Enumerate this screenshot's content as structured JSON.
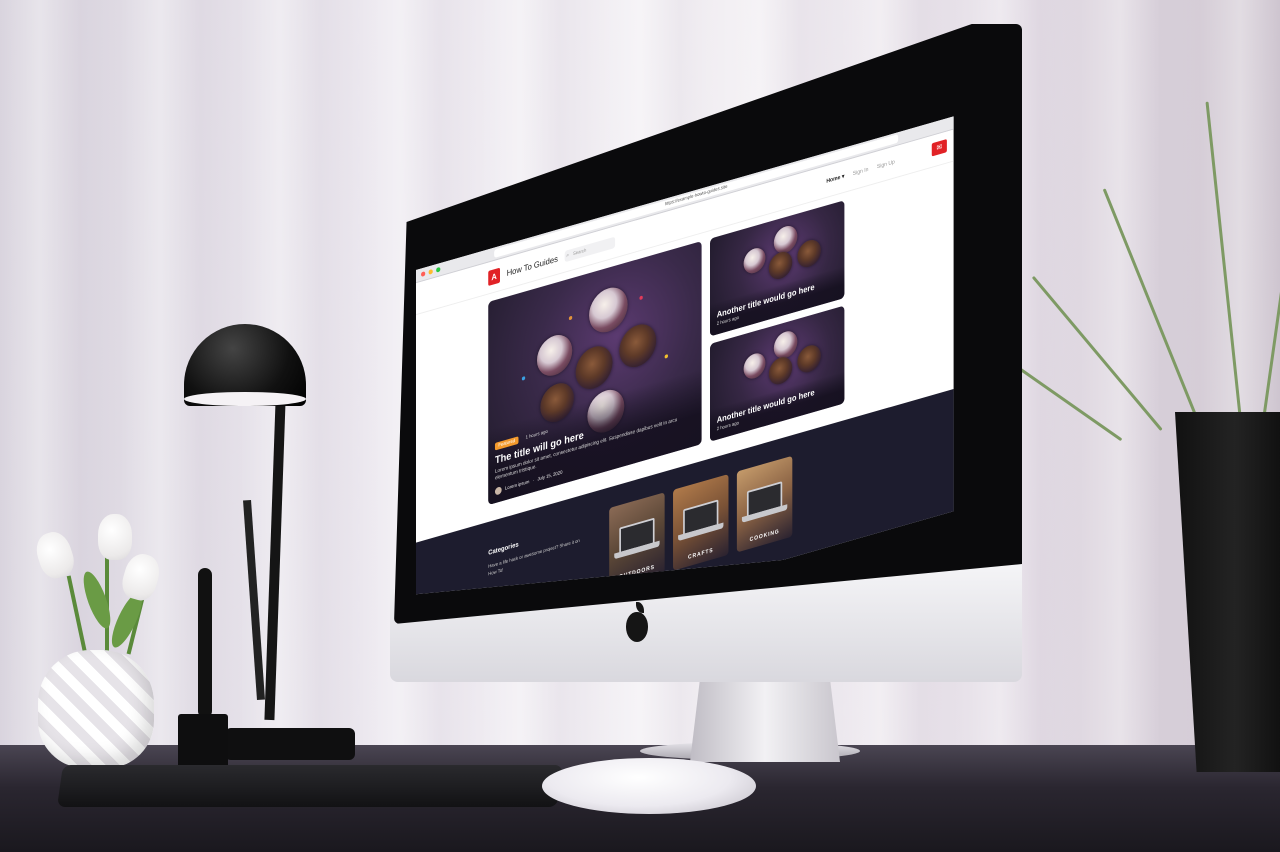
{
  "browser": {
    "url": "https://example-howto-guides.site"
  },
  "site": {
    "logo_letter": "A",
    "logo_text": "How To Guides",
    "search_placeholder": "Search",
    "nav": {
      "home": "Home",
      "sign_in": "Sign In",
      "sign_up": "Sign Up"
    },
    "mail_icon": "envelope-icon",
    "brand_color": "#e12226"
  },
  "hero": {
    "badge": "Featured",
    "time": "1 hours ago",
    "title": "The title will go here",
    "excerpt": "Lorem ipsum dolor sit amet, consectetur adipiscing elit. Suspendisse dapibus velit in arcu elementum tristique.",
    "author": "Lorem ipsum",
    "date": "July 15, 2020",
    "badge_color": "#f39a2c"
  },
  "side_cards": [
    {
      "title": "Another title would go here",
      "time": "2 hours ago"
    },
    {
      "title": "Another title would go here",
      "time": "2 hours ago"
    }
  ],
  "footer": {
    "heading": "Categories",
    "text": "Have a life hack or awesome project? Share it on How To!",
    "categories": [
      {
        "label": "OUTDOORS"
      },
      {
        "label": "CRAFTS"
      },
      {
        "label": "COOKING"
      }
    ]
  }
}
